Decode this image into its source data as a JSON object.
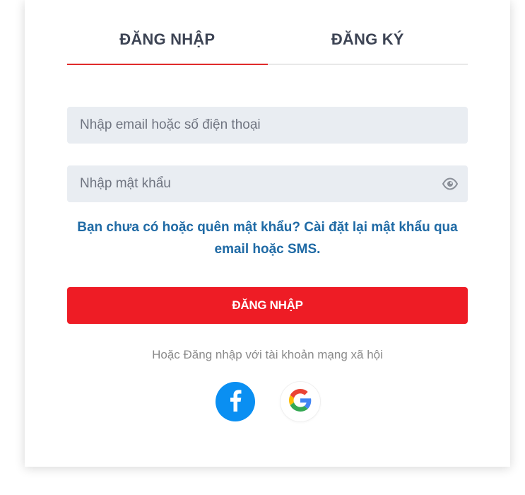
{
  "tabs": {
    "login_label": "ĐĂNG NHẬP",
    "register_label": "ĐĂNG KÝ"
  },
  "form": {
    "email_placeholder": "Nhập email hoặc số điện thoại",
    "email_value": "",
    "password_placeholder": "Nhập mật khẩu",
    "password_value": "",
    "forgot_text": "Bạn chưa có hoặc quên mật khẩu? Cài đặt lại mật khẩu qua email hoặc SMS.",
    "submit_label": "ĐĂNG NHẬP"
  },
  "social": {
    "prompt": "Hoặc Đăng nhập với tài khoản mạng xã hội",
    "facebook_icon": "facebook-icon",
    "google_icon": "google-icon"
  },
  "colors": {
    "accent_red": "#ee1c25",
    "tab_underline": "#e02b2b",
    "link_blue": "#1f6aa5",
    "facebook_blue": "#0a8ff2",
    "input_bg": "#e9edf2"
  }
}
